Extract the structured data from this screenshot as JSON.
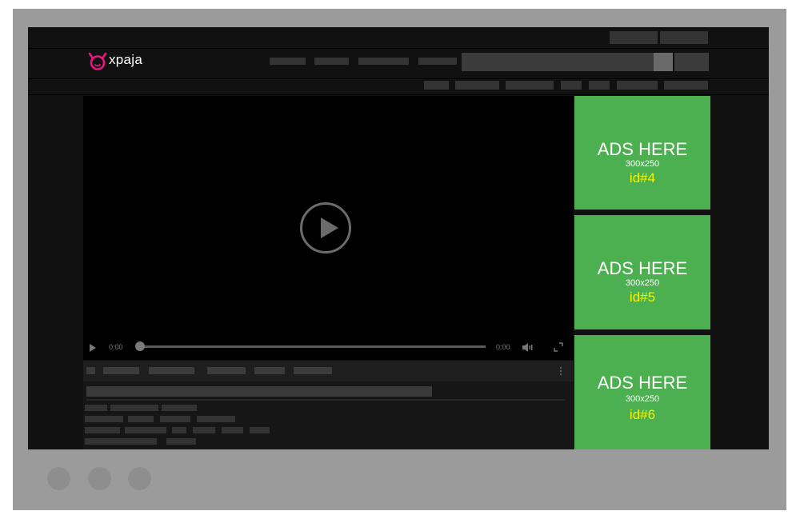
{
  "header": {
    "logo_text": "xpaja",
    "brand_color": "#e8177d"
  },
  "player": {
    "current_time": "0:00",
    "duration": "0:00",
    "progress": 0
  },
  "ads": [
    {
      "title": "ADS HERE",
      "size": "300x250",
      "id": "id#4"
    },
    {
      "title": "ADS HERE",
      "size": "300x250",
      "id": "id#5"
    },
    {
      "title": "ADS HERE",
      "size": "300x250",
      "id": "id#6"
    }
  ],
  "colors": {
    "frame": "#9b9b9b",
    "ad_background": "#4caf50",
    "ad_id": "#f5f500"
  }
}
